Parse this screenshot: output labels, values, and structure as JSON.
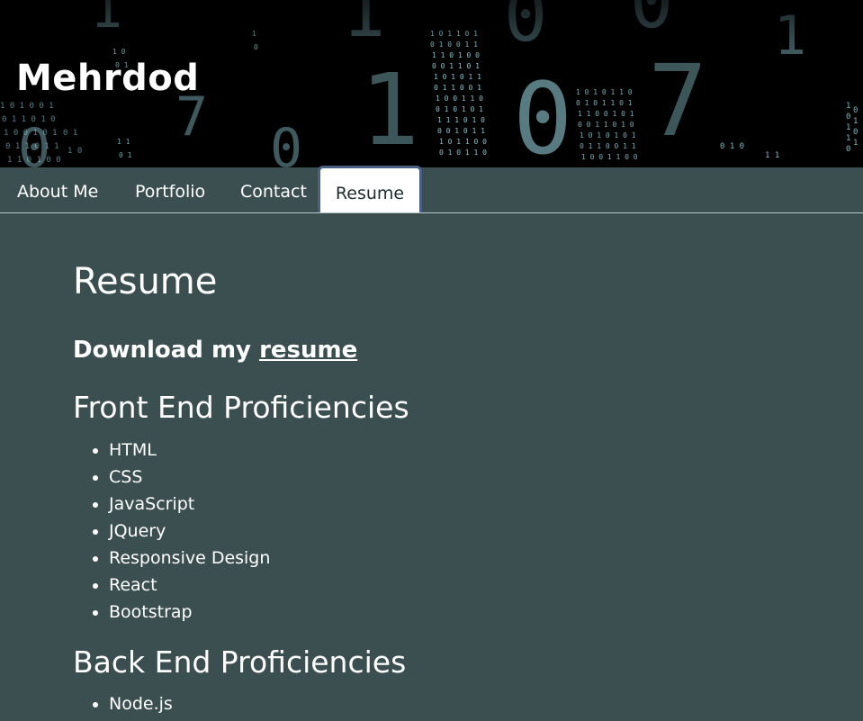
{
  "header": {
    "title": "Mehrdod",
    "banner_glyphs": [
      "0",
      "1",
      "7",
      "0",
      "1",
      "0",
      "7",
      "1",
      "0",
      "1",
      "0"
    ]
  },
  "nav": {
    "tabs": [
      {
        "label": "About Me",
        "active": false
      },
      {
        "label": "Portfolio",
        "active": false
      },
      {
        "label": "Contact",
        "active": false
      },
      {
        "label": "Resume",
        "active": true
      }
    ]
  },
  "main": {
    "heading": "Resume",
    "download_prefix": "Download my ",
    "download_link": "resume",
    "front_end": {
      "title": "Front End Proficiencies",
      "items": [
        "HTML",
        "CSS",
        "JavaScript",
        "JQuery",
        "Responsive Design",
        "React",
        "Bootstrap"
      ]
    },
    "back_end": {
      "title": "Back End Proficiencies",
      "items": [
        "Node.js"
      ]
    }
  },
  "colors": {
    "page_background": "#3c4f50",
    "active_tab_background": "#ffffff",
    "active_tab_border": "#4a5f86",
    "banner_digits": "#9fe0ea"
  }
}
